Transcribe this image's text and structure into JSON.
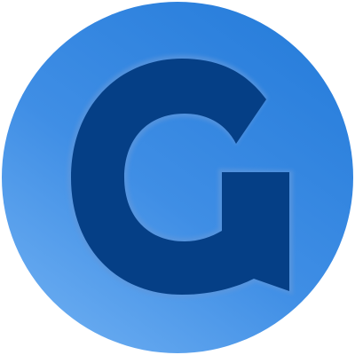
{
  "logo": {
    "icon": "g-letter-logo-icon",
    "letter": "G",
    "colors": {
      "circle_light": "#67aaf0",
      "circle_mid": "#3f8ee5",
      "circle_dark": "#2a7fdc",
      "letter_fill": "#053f86",
      "letter_highlight": "#5f97dc",
      "background": "#ffffff"
    }
  }
}
